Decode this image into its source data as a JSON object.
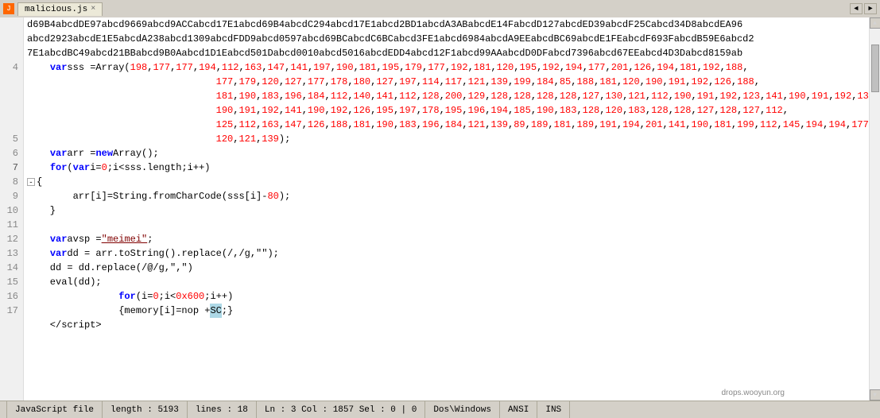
{
  "titlebar": {
    "tab_label": "malicious.js",
    "close_symbol": "×",
    "nav_left": "◄",
    "nav_right": "►"
  },
  "lines": [
    {
      "num": "",
      "content_id": "line_hex",
      "fold": true
    },
    {
      "num": "4",
      "content_id": "line_4"
    },
    {
      "num": "",
      "content_id": "line_4b"
    },
    {
      "num": "5",
      "content_id": "line_5"
    },
    {
      "num": "6",
      "content_id": "line_6"
    },
    {
      "num": "7",
      "content_id": "line_7",
      "fold": true
    },
    {
      "num": "8",
      "content_id": "line_8"
    },
    {
      "num": "9",
      "content_id": "line_9"
    },
    {
      "num": "10",
      "content_id": "line_10"
    },
    {
      "num": "11",
      "content_id": "line_11"
    },
    {
      "num": "12",
      "content_id": "line_12"
    },
    {
      "num": "13",
      "content_id": "line_13"
    },
    {
      "num": "14",
      "content_id": "line_14"
    },
    {
      "num": "15",
      "content_id": "line_15"
    },
    {
      "num": "16",
      "content_id": "line_16"
    },
    {
      "num": "17",
      "content_id": "line_17"
    }
  ],
  "statusbar": {
    "filetype": "JavaScript file",
    "length": "length : 5193",
    "lines": "lines : 18",
    "position": "Ln : 3   Col : 1857   Sel : 0 | 0",
    "lineending": "Dos\\Windows",
    "encoding": "ANSI",
    "mode": "INS"
  },
  "watermark": "drops.wooyun.org"
}
